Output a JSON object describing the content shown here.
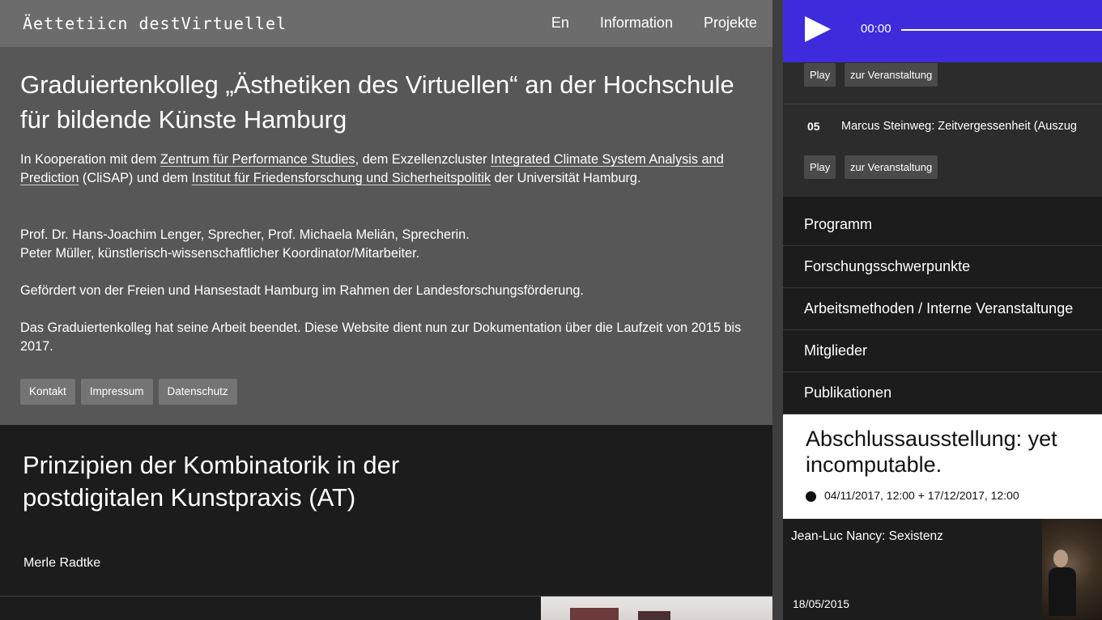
{
  "header": {
    "logo": "Äettetiicn destVirtuellel",
    "nav": [
      "En",
      "Information",
      "Projekte"
    ]
  },
  "info": {
    "title": "Graduiertenkolleg „Ästhetiken des Virtuellen“ an der Hochschule für bildende Künste Hamburg",
    "p1": {
      "t1": "In Kooperation mit dem ",
      "link1": "Zentrum für Performance Studies",
      "t2": ", dem Exzellenzcluster ",
      "link2": "Integrated Climate System Analysis and Prediction",
      "t3": " (CliSAP) und dem ",
      "link3": "Institut für Friedensforschung und Sicherheitspolitik",
      "t4": " der Universität Hamburg."
    },
    "p2_line1": "Prof. Dr. Hans-Joachim Lenger, Sprecher, Prof. Michaela Melián, Sprecherin.",
    "p2_line2": "Peter Müller, künstlerisch-wissenschaftlicher Koordinator/Mitarbeiter.",
    "p3": "Gefördert von der Freien und Hansestadt Hamburg im Rahmen der Landesforschungsförderung.",
    "p4": "Das Graduiertenkolleg hat seine Arbeit beendet. Diese Website dient nun zur Dokumentation über die Laufzeit von 2015 bis 2017.",
    "buttons": [
      "Kontakt",
      "Impressum",
      "Datenschutz"
    ]
  },
  "project": {
    "title": "Prinzipien der Kombinatorik in der postdigitalen Kunstpraxis (AT)",
    "author": "Merle Radtke"
  },
  "player": {
    "time": "00:00",
    "progress": 0
  },
  "playlist": {
    "row1": {
      "play": "Play",
      "event": "zur Veranstaltung"
    },
    "row2": {
      "number": "05",
      "title": "Marcus Steinweg: Zeitvergessenheit (Auszug",
      "play": "Play",
      "event": "zur Veranstaltung"
    }
  },
  "menu": [
    "Programm",
    "Forschungsschwerpunkte",
    "Arbeitsmethoden / Interne Veranstaltunge",
    "Mitglieder",
    "Publikationen"
  ],
  "event": {
    "title": "Abschlussausstellung: yet incomputable.",
    "dates": "04/11/2017, 12:00  + 17/12/2017, 12:00"
  },
  "media": {
    "title": "Jean-Luc Nancy: Sexistenz",
    "date": "18/05/2015"
  }
}
